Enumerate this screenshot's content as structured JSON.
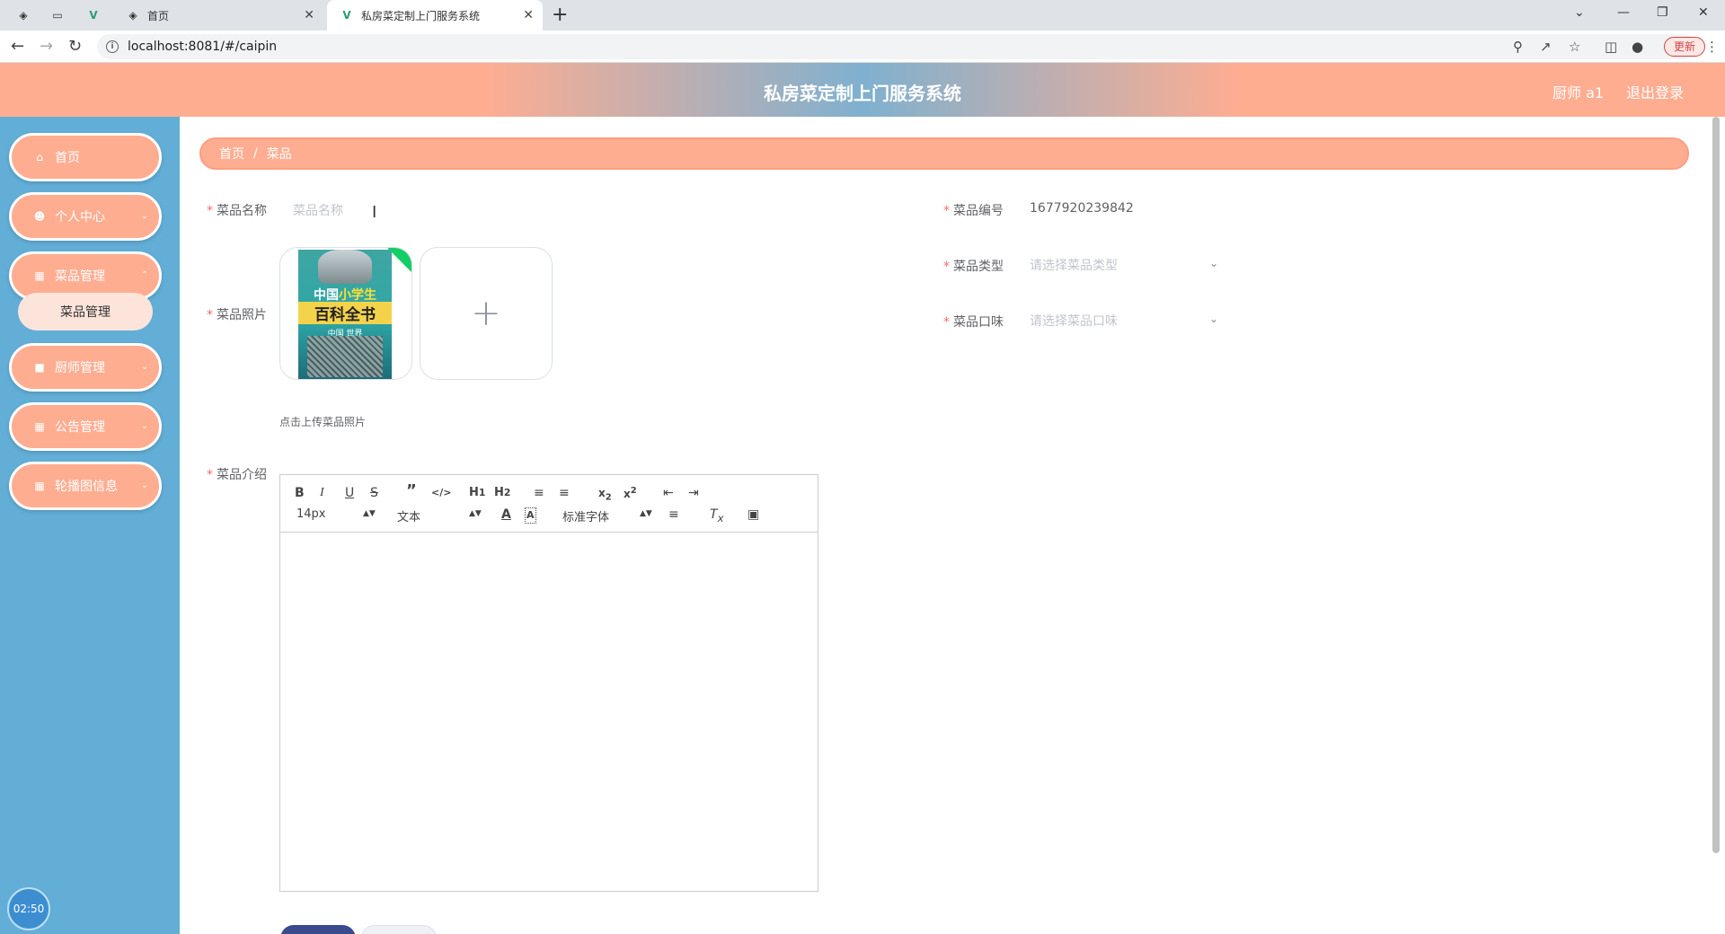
{
  "browser": {
    "tabs": [
      {
        "title": "首页"
      },
      {
        "title": "私房菜定制上门服务系统"
      }
    ],
    "url": "localhost:8081/#/caipin",
    "update_label": "更新"
  },
  "header": {
    "title": "私房菜定制上门服务系统",
    "user": "厨师 a1",
    "logout": "退出登录"
  },
  "sidebar": {
    "items": [
      {
        "label": "首页",
        "icon": "home-icon"
      },
      {
        "label": "个人中心",
        "icon": "user-icon"
      },
      {
        "label": "菜品管理",
        "icon": "file-icon"
      },
      {
        "label": "厨师管理",
        "icon": "chef-icon"
      },
      {
        "label": "公告管理",
        "icon": "grid-icon"
      },
      {
        "label": "轮播图信息",
        "icon": "grid-icon"
      }
    ],
    "submenu_label": "菜品管理",
    "clock": "02:50"
  },
  "breadcrumb": {
    "home": "首页",
    "sep": "/",
    "current": "菜品"
  },
  "form": {
    "name_label": "菜品名称",
    "name_placeholder": "菜品名称",
    "code_label": "菜品编号",
    "code_value": "1677920239842",
    "type_label": "菜品类型",
    "type_placeholder": "请选择菜品类型",
    "taste_label": "菜品口味",
    "taste_placeholder": "请选择菜品口味",
    "photo_label": "菜品照片",
    "photo_tip": "点击上传菜品照片",
    "intro_label": "菜品介绍",
    "book": {
      "line1a": "中国",
      "line1b": "小学生",
      "line2": "百科全书",
      "line3": "中国 世界"
    },
    "add_symbol": "+"
  },
  "editor": {
    "font_size": "14px",
    "header_select": "文本",
    "font_family": "标准字体"
  }
}
